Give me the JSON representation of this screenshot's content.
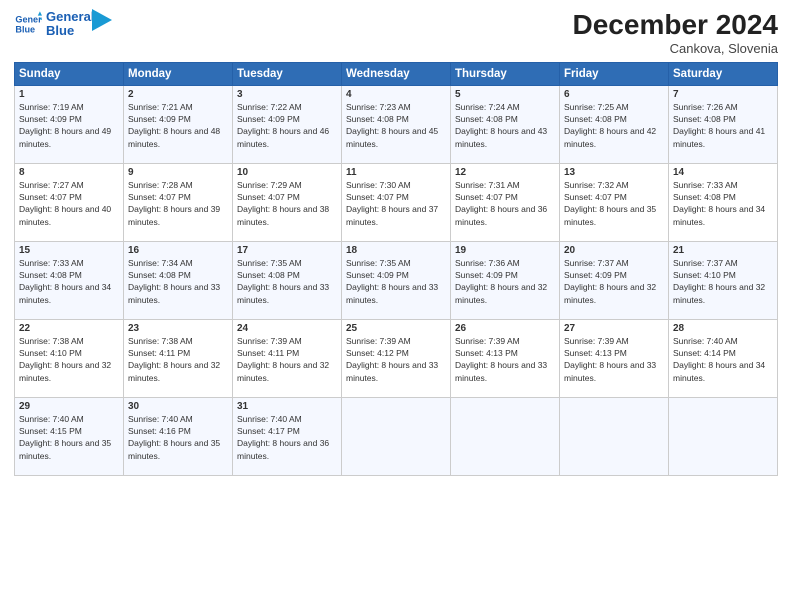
{
  "header": {
    "logo_line1": "General",
    "logo_line2": "Blue",
    "main_title": "December 2024",
    "sub_title": "Cankova, Slovenia"
  },
  "days_of_week": [
    "Sunday",
    "Monday",
    "Tuesday",
    "Wednesday",
    "Thursday",
    "Friday",
    "Saturday"
  ],
  "weeks": [
    [
      {
        "day": "1",
        "sunrise": "Sunrise: 7:19 AM",
        "sunset": "Sunset: 4:09 PM",
        "daylight": "Daylight: 8 hours and 49 minutes."
      },
      {
        "day": "2",
        "sunrise": "Sunrise: 7:21 AM",
        "sunset": "Sunset: 4:09 PM",
        "daylight": "Daylight: 8 hours and 48 minutes."
      },
      {
        "day": "3",
        "sunrise": "Sunrise: 7:22 AM",
        "sunset": "Sunset: 4:09 PM",
        "daylight": "Daylight: 8 hours and 46 minutes."
      },
      {
        "day": "4",
        "sunrise": "Sunrise: 7:23 AM",
        "sunset": "Sunset: 4:08 PM",
        "daylight": "Daylight: 8 hours and 45 minutes."
      },
      {
        "day": "5",
        "sunrise": "Sunrise: 7:24 AM",
        "sunset": "Sunset: 4:08 PM",
        "daylight": "Daylight: 8 hours and 43 minutes."
      },
      {
        "day": "6",
        "sunrise": "Sunrise: 7:25 AM",
        "sunset": "Sunset: 4:08 PM",
        "daylight": "Daylight: 8 hours and 42 minutes."
      },
      {
        "day": "7",
        "sunrise": "Sunrise: 7:26 AM",
        "sunset": "Sunset: 4:08 PM",
        "daylight": "Daylight: 8 hours and 41 minutes."
      }
    ],
    [
      {
        "day": "8",
        "sunrise": "Sunrise: 7:27 AM",
        "sunset": "Sunset: 4:07 PM",
        "daylight": "Daylight: 8 hours and 40 minutes."
      },
      {
        "day": "9",
        "sunrise": "Sunrise: 7:28 AM",
        "sunset": "Sunset: 4:07 PM",
        "daylight": "Daylight: 8 hours and 39 minutes."
      },
      {
        "day": "10",
        "sunrise": "Sunrise: 7:29 AM",
        "sunset": "Sunset: 4:07 PM",
        "daylight": "Daylight: 8 hours and 38 minutes."
      },
      {
        "day": "11",
        "sunrise": "Sunrise: 7:30 AM",
        "sunset": "Sunset: 4:07 PM",
        "daylight": "Daylight: 8 hours and 37 minutes."
      },
      {
        "day": "12",
        "sunrise": "Sunrise: 7:31 AM",
        "sunset": "Sunset: 4:07 PM",
        "daylight": "Daylight: 8 hours and 36 minutes."
      },
      {
        "day": "13",
        "sunrise": "Sunrise: 7:32 AM",
        "sunset": "Sunset: 4:07 PM",
        "daylight": "Daylight: 8 hours and 35 minutes."
      },
      {
        "day": "14",
        "sunrise": "Sunrise: 7:33 AM",
        "sunset": "Sunset: 4:08 PM",
        "daylight": "Daylight: 8 hours and 34 minutes."
      }
    ],
    [
      {
        "day": "15",
        "sunrise": "Sunrise: 7:33 AM",
        "sunset": "Sunset: 4:08 PM",
        "daylight": "Daylight: 8 hours and 34 minutes."
      },
      {
        "day": "16",
        "sunrise": "Sunrise: 7:34 AM",
        "sunset": "Sunset: 4:08 PM",
        "daylight": "Daylight: 8 hours and 33 minutes."
      },
      {
        "day": "17",
        "sunrise": "Sunrise: 7:35 AM",
        "sunset": "Sunset: 4:08 PM",
        "daylight": "Daylight: 8 hours and 33 minutes."
      },
      {
        "day": "18",
        "sunrise": "Sunrise: 7:35 AM",
        "sunset": "Sunset: 4:09 PM",
        "daylight": "Daylight: 8 hours and 33 minutes."
      },
      {
        "day": "19",
        "sunrise": "Sunrise: 7:36 AM",
        "sunset": "Sunset: 4:09 PM",
        "daylight": "Daylight: 8 hours and 32 minutes."
      },
      {
        "day": "20",
        "sunrise": "Sunrise: 7:37 AM",
        "sunset": "Sunset: 4:09 PM",
        "daylight": "Daylight: 8 hours and 32 minutes."
      },
      {
        "day": "21",
        "sunrise": "Sunrise: 7:37 AM",
        "sunset": "Sunset: 4:10 PM",
        "daylight": "Daylight: 8 hours and 32 minutes."
      }
    ],
    [
      {
        "day": "22",
        "sunrise": "Sunrise: 7:38 AM",
        "sunset": "Sunset: 4:10 PM",
        "daylight": "Daylight: 8 hours and 32 minutes."
      },
      {
        "day": "23",
        "sunrise": "Sunrise: 7:38 AM",
        "sunset": "Sunset: 4:11 PM",
        "daylight": "Daylight: 8 hours and 32 minutes."
      },
      {
        "day": "24",
        "sunrise": "Sunrise: 7:39 AM",
        "sunset": "Sunset: 4:11 PM",
        "daylight": "Daylight: 8 hours and 32 minutes."
      },
      {
        "day": "25",
        "sunrise": "Sunrise: 7:39 AM",
        "sunset": "Sunset: 4:12 PM",
        "daylight": "Daylight: 8 hours and 33 minutes."
      },
      {
        "day": "26",
        "sunrise": "Sunrise: 7:39 AM",
        "sunset": "Sunset: 4:13 PM",
        "daylight": "Daylight: 8 hours and 33 minutes."
      },
      {
        "day": "27",
        "sunrise": "Sunrise: 7:39 AM",
        "sunset": "Sunset: 4:13 PM",
        "daylight": "Daylight: 8 hours and 33 minutes."
      },
      {
        "day": "28",
        "sunrise": "Sunrise: 7:40 AM",
        "sunset": "Sunset: 4:14 PM",
        "daylight": "Daylight: 8 hours and 34 minutes."
      }
    ],
    [
      {
        "day": "29",
        "sunrise": "Sunrise: 7:40 AM",
        "sunset": "Sunset: 4:15 PM",
        "daylight": "Daylight: 8 hours and 35 minutes."
      },
      {
        "day": "30",
        "sunrise": "Sunrise: 7:40 AM",
        "sunset": "Sunset: 4:16 PM",
        "daylight": "Daylight: 8 hours and 35 minutes."
      },
      {
        "day": "31",
        "sunrise": "Sunrise: 7:40 AM",
        "sunset": "Sunset: 4:17 PM",
        "daylight": "Daylight: 8 hours and 36 minutes."
      },
      null,
      null,
      null,
      null
    ]
  ]
}
